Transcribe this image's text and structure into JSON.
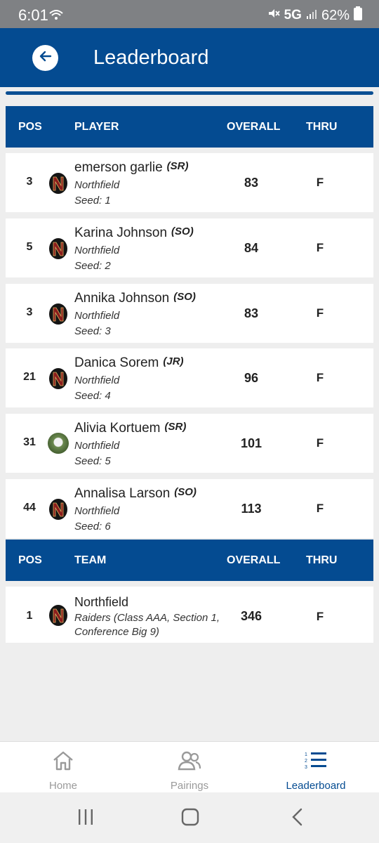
{
  "status_bar": {
    "time": "6:01",
    "network": "5G",
    "battery": "62%"
  },
  "header": {
    "title": "Leaderboard",
    "back_icon": "arrow-left-icon"
  },
  "progress": {
    "fraction": 1.0
  },
  "player_table": {
    "columns": {
      "pos": "POS",
      "player": "PLAYER",
      "overall": "OVERALL",
      "thru": "THRU"
    },
    "rows": [
      {
        "pos": "3",
        "name": "emerson garlie",
        "class": "(SR)",
        "team": "Northfield",
        "seed": "Seed: 1",
        "overall": "83",
        "thru": "F",
        "icon": "northfield-logo-icon"
      },
      {
        "pos": "5",
        "name": "Karina Johnson",
        "class": "(SO)",
        "team": "Northfield",
        "seed": "Seed: 2",
        "overall": "84",
        "thru": "F",
        "icon": "northfield-logo-icon"
      },
      {
        "pos": "3",
        "name": "Annika Johnson",
        "class": "(SO)",
        "team": "Northfield",
        "seed": "Seed: 3",
        "overall": "83",
        "thru": "F",
        "icon": "northfield-logo-icon"
      },
      {
        "pos": "21",
        "name": "Danica Sorem",
        "class": "(JR)",
        "team": "Northfield",
        "seed": "Seed: 4",
        "overall": "96",
        "thru": "F",
        "icon": "northfield-logo-icon"
      },
      {
        "pos": "31",
        "name": "Alivia Kortuem",
        "class": "(SR)",
        "team": "Northfield",
        "seed": "Seed: 5",
        "overall": "101",
        "thru": "F",
        "icon": "golf-ball-avatar"
      },
      {
        "pos": "44",
        "name": "Annalisa Larson",
        "class": "(SO)",
        "team": "Northfield",
        "seed": "Seed: 6",
        "overall": "113",
        "thru": "F",
        "icon": "northfield-logo-icon"
      }
    ]
  },
  "team_table": {
    "columns": {
      "pos": "POS",
      "team": "TEAM",
      "overall": "OVERALL",
      "thru": "THRU"
    },
    "rows": [
      {
        "pos": "1",
        "name": "Northfield",
        "desc": "Raiders (Class AAA, Section 1, Conference Big 9)",
        "overall": "346",
        "thru": "F",
        "icon": "northfield-logo-icon"
      }
    ]
  },
  "bottom_nav": {
    "items": [
      {
        "label": "Home",
        "icon": "home-icon",
        "active": false
      },
      {
        "label": "Pairings",
        "icon": "people-icon",
        "active": false
      },
      {
        "label": "Leaderboard",
        "icon": "ranked-list-icon",
        "active": true
      }
    ]
  },
  "colors": {
    "primary": "#044b91",
    "logo_red": "#7a1a1a",
    "active_nav": "#044b91",
    "inactive_nav": "#9a9a9a"
  }
}
